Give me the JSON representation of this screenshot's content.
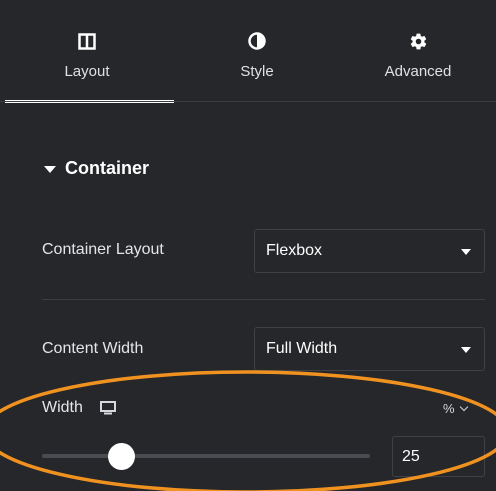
{
  "tabs": [
    {
      "label": "Layout",
      "icon": "columns-icon",
      "active": true
    },
    {
      "label": "Style",
      "icon": "half-circle-icon",
      "active": false
    },
    {
      "label": "Advanced",
      "icon": "gear-icon",
      "active": false
    }
  ],
  "section": {
    "title": "Container",
    "icon": "caret-down-icon"
  },
  "controls": {
    "container_layout": {
      "label": "Container Layout",
      "value": "Flexbox"
    },
    "content_width": {
      "label": "Content Width",
      "value": "Full Width"
    },
    "width": {
      "label": "Width",
      "device_icon": "desktop-icon",
      "unit": "%",
      "value": "25",
      "slider_fraction": 0.25
    }
  },
  "colors": {
    "background": "#26272b",
    "highlight": "#f0921f",
    "text": "#ffffff"
  }
}
